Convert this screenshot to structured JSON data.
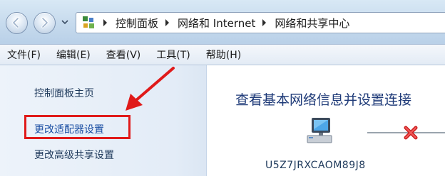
{
  "address_bar": {
    "icon": "control-panel-icon",
    "breadcrumbs": [
      "控制面板",
      "网络和 Internet",
      "网络和共享中心"
    ]
  },
  "menu": {
    "items": [
      "文件(F)",
      "编辑(E)",
      "查看(V)",
      "工具(T)",
      "帮助(H)"
    ]
  },
  "sidebar": {
    "links": [
      "控制面板主页",
      "更改适配器设置",
      "更改高级共享设置"
    ]
  },
  "main": {
    "title": "查看基本网络信息并设置连接",
    "computer_name": "U5Z7JRXCAOM89J8",
    "connection_status_icon": "disconnected-x-icon"
  },
  "colors": {
    "annotation": "#e01a1a",
    "link": "#1b4fa3",
    "title": "#1e3a78"
  }
}
